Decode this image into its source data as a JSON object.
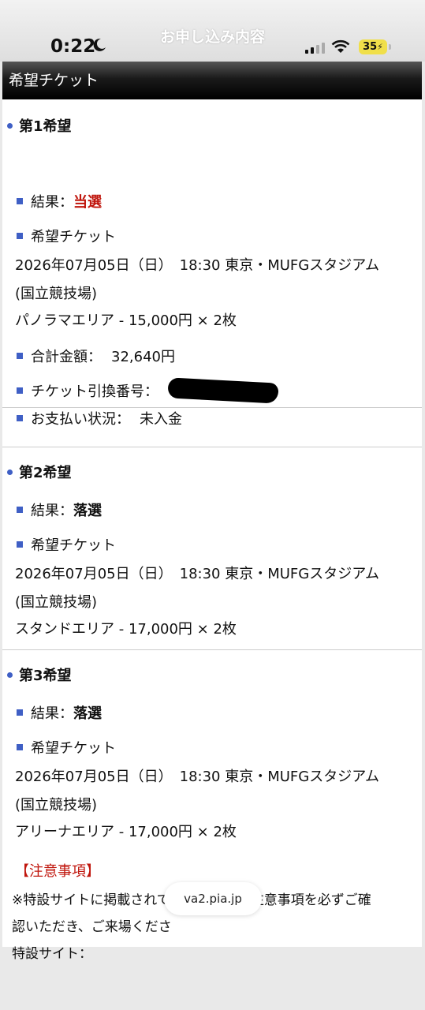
{
  "status": {
    "time": "0:22",
    "battery": "35",
    "page_title": "お申し込み内容"
  },
  "header": {
    "title": "希望チケット"
  },
  "choices": [
    {
      "title": "第1希望",
      "result_label": "結果：",
      "result_value": "当選",
      "ticket_label": "希望チケット",
      "event_line1": "2026年07月05日（日）　18:30  東京・MUFGスタジアム",
      "event_line2": "(国立競技場)",
      "seat": "パノラマエリア - 15,000円 × 2枚",
      "total_label": "合計金額：",
      "total_value": "32,640円",
      "exchange_label": "チケット引換番号：",
      "payment_label": "お支払い状況：",
      "payment_value": "未入金"
    },
    {
      "title": "第2希望",
      "result_label": "結果：",
      "result_value": "落選",
      "ticket_label": "希望チケット",
      "event_line1": "2026年07月05日（日）　18:30  東京・MUFGスタジアム",
      "event_line2": "(国立競技場)",
      "seat": "スタンドエリア - 17,000円 × 2枚"
    },
    {
      "title": "第3希望",
      "result_label": "結果：",
      "result_value": "落選",
      "ticket_label": "希望チケット",
      "event_line1": "2026年07月05日（日）　18:30  東京・MUFGスタジアム",
      "event_line2": "(国立競技場)",
      "seat": "アリーナエリア - 17,000円 × 2枚"
    }
  ],
  "notice": {
    "title": "【注意事項】",
    "text_line1": "※特設サイトに掲載されているご案内と注意事項を必ずご確",
    "text_line2": "認いただき、ご来場くださ",
    "site_label": "特設サイト："
  },
  "browser": {
    "url": "va2.pia.jp"
  }
}
